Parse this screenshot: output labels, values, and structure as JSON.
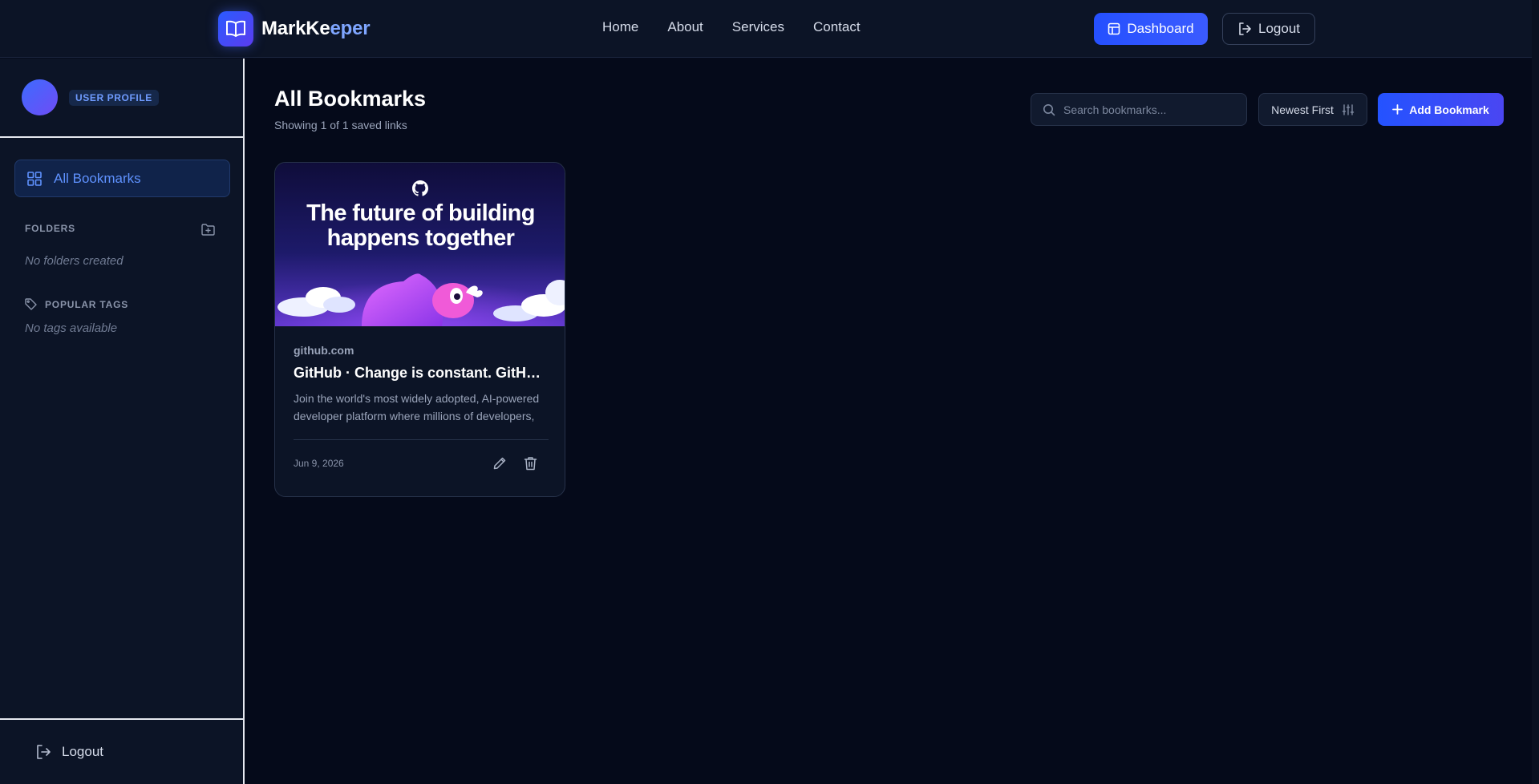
{
  "navbar": {
    "brand_part1": "MarkKe",
    "brand_part2": "eper",
    "links": [
      "Home",
      "About",
      "Services",
      "Contact"
    ],
    "dashboard_label": "Dashboard",
    "logout_label": "Logout"
  },
  "sidebar": {
    "profile_badge": "USER PROFILE",
    "all_bookmarks_label": "All Bookmarks",
    "folders_heading": "FOLDERS",
    "folders_empty": "No folders created",
    "tags_heading": "POPULAR TAGS",
    "tags_empty": "No tags available",
    "logout_label": "Logout"
  },
  "main": {
    "title": "All Bookmarks",
    "subtitle": "Showing 1 of 1 saved links",
    "search_placeholder": "Search bookmarks...",
    "sort_label": "Newest First",
    "add_label": "Add Bookmark"
  },
  "bookmarks": [
    {
      "image_text": "The future of building happens together",
      "domain": "github.com",
      "title": "GitHub · Change is constant. GitHub keeps you ahead.",
      "description": "Join the world's most widely adopted, AI-powered developer platform where millions of developers, businesses, and the largest open source community build software.",
      "date": "Jun 9, 2026"
    }
  ],
  "colors": {
    "background": "#050a1a",
    "panel": "#0c1426",
    "accent": "#2550ff",
    "accent_text": "#5f92ff"
  }
}
